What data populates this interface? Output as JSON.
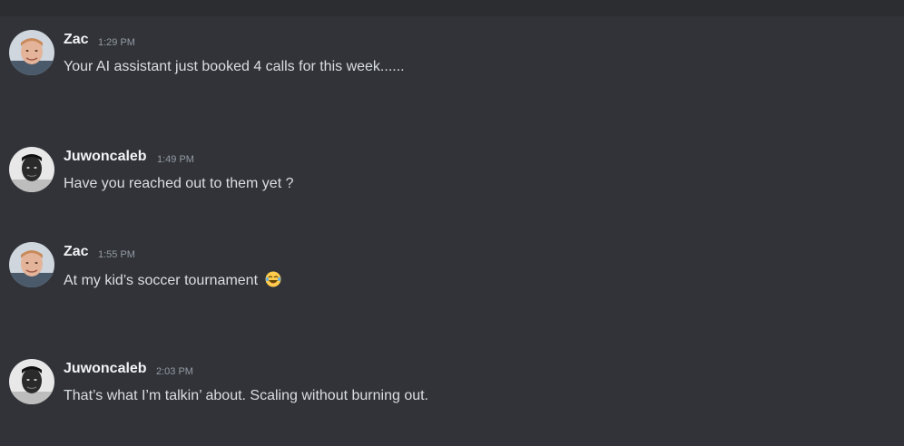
{
  "messages": [
    {
      "author": "Zac",
      "time": "1:29 PM",
      "text": "Your AI assistant just booked 4 calls for this week......",
      "avatar": "avatar-zac-icon",
      "emoji": null
    },
    {
      "author": "Juwoncaleb",
      "time": "1:49 PM",
      "text": "Have you reached out to them yet ?",
      "avatar": "avatar-juwoncaleb-icon",
      "emoji": null
    },
    {
      "author": "Zac",
      "time": "1:55 PM",
      "text": "At my kid’s soccer tournament",
      "avatar": "avatar-zac-icon",
      "emoji": "laughing-face-with-tears-icon"
    },
    {
      "author": "Juwoncaleb",
      "time": "2:03 PM",
      "text": "That’s what I’m talkin’ about. Scaling without burning out.",
      "avatar": "avatar-juwoncaleb-icon",
      "emoji": null
    }
  ],
  "colors": {
    "background": "#313338",
    "topbar": "#2b2d31",
    "author": "#f2f3f5",
    "timestamp": "#949ba4",
    "message": "#dbdee1"
  }
}
